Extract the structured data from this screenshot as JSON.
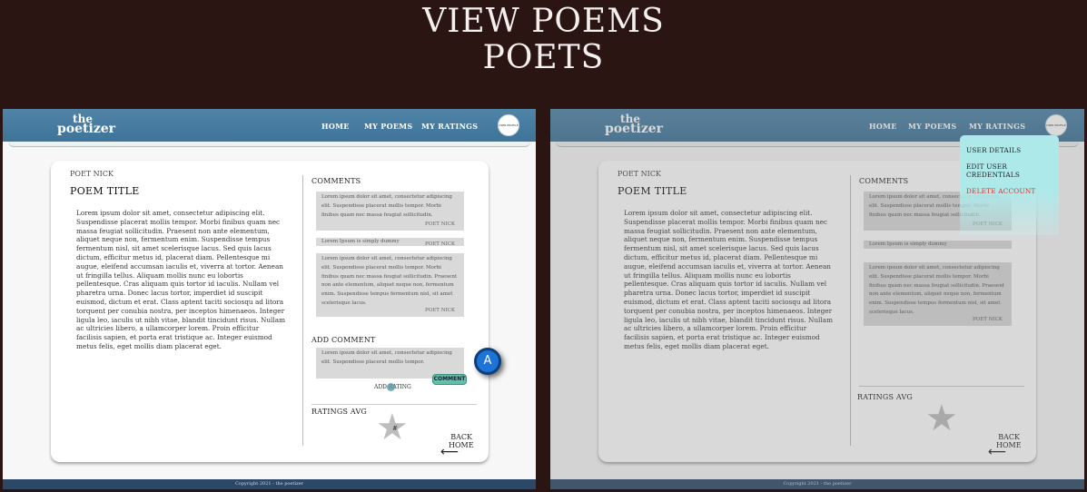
{
  "heading": {
    "line1": "VIEW POEMS",
    "line2": "POETS"
  },
  "colors": {
    "background": "#2a1513",
    "navbar": "#4679a0",
    "accent": "#63c0a8",
    "fab": "#1c73d8",
    "danger": "#d9322c"
  },
  "logo": {
    "line1": "the",
    "line2": "poetizer"
  },
  "nav": {
    "home": "HOME",
    "my_poems": "MY POEMS",
    "my_ratings": "MY RATINGS",
    "profile_label": "USER PROFILE"
  },
  "poem": {
    "poet_nick": "POET NICK",
    "title": "POEM TITLE",
    "body": "Lorem ipsum dolor sit amet, consectetur adipiscing elit. Suspendisse placerat mollis tempor. Morbi finibus quam nec massa feugiat sollicitudin. Praesent non ante elementum, aliquet neque non, fermentum enim. Suspendisse tempus fermentum nisl, sit amet scelerisque lacus. Sed quis lacus dictum, efficitur metus id, placerat diam. Pellentesque mi augue, eleifend accumsan iaculis et, viverra at tortor. Aenean ut fringilla tellus. Aliquam mollis nunc eu lobortis pellentesque. Cras aliquam quis tortor id iaculis. Nullam vel pharetra urna. Donec lacus tortor, imperdiet id suscipit euismod, dictum et erat. Class aptent taciti sociosqu ad litora torquent per conubia nostra, per inceptos himenaeos. Integer ligula leo, iaculis ut nibh vitae, blandit tincidunt risus. Nullam ac ultricies libero, a ullamcorper lorem. Proin efficitur facilisis sapien, et porta erat tristique ac. Integer euismod metus felis, eget mollis diam placerat eget."
  },
  "comments": {
    "label": "COMMENTS",
    "items": [
      {
        "text": "Lorem ipsum dolor sit amet, consectetur adipiscing elit. Suspendisse placerat mollis tempor. Morbi finibus quam nec massa feugiat sollicitudin.",
        "nick": "POET NICK"
      },
      {
        "text": "Lorem Ipsum is simply dummy",
        "nick": "POET NICK"
      },
      {
        "text": "Lorem ipsum dolor sit amet, consectetur adipiscing elit. Suspendisse placerat mollis tempor. Morbi finibus quam nec massa feugiat sollicitudin. Praesent non ante elementum, aliquet neque non, fermentum enim. Suspendisse tempus fermentum nisl, sit amet scelerisque lacus.",
        "nick": "POET NICK"
      }
    ]
  },
  "add_comment": {
    "label": "ADD COMMENT",
    "text": "Lorem ipsum dolor sit amet, consectetur adipiscing elit. Suspendisse placerat mollis tempor.",
    "button": "COMMENT",
    "add_rating": "ADD RATING"
  },
  "ratings": {
    "label": "RATINGS AVG",
    "value": "#"
  },
  "back_home": {
    "line1": "BACK",
    "line2": "HOME",
    "arrow": "⟵"
  },
  "fab": {
    "label": "A"
  },
  "footer": {
    "text": "Copyright 2021 - the poetizer"
  },
  "dropdown": {
    "items": [
      "USER DETAILS",
      "EDIT USER CREDENTIALS"
    ],
    "delete": "DELETE ACCOUNT"
  }
}
